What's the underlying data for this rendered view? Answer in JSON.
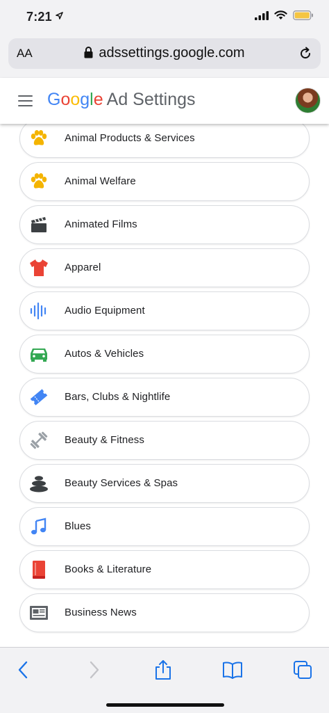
{
  "status_bar": {
    "time": "7:21"
  },
  "browser": {
    "aa_label": "AA",
    "url": "adssettings.google.com"
  },
  "header": {
    "logo_letters": [
      "G",
      "o",
      "o",
      "g",
      "l",
      "e"
    ],
    "title": "Ad Settings"
  },
  "categories": [
    {
      "label": "",
      "icon": "partial-item"
    },
    {
      "label": "Animal Products & Services",
      "icon": "paw-icon",
      "color": "#f4b400"
    },
    {
      "label": "Animal Welfare",
      "icon": "paw-icon",
      "color": "#f4b400"
    },
    {
      "label": "Animated Films",
      "icon": "clapperboard-icon",
      "color": "#3c4043"
    },
    {
      "label": "Apparel",
      "icon": "tshirt-icon",
      "color": "#ea4335"
    },
    {
      "label": "Audio Equipment",
      "icon": "sound-wave-icon",
      "color": "#4285f4"
    },
    {
      "label": "Autos & Vehicles",
      "icon": "car-icon",
      "color": "#34a853"
    },
    {
      "label": "Bars, Clubs & Nightlife",
      "icon": "ticket-icon",
      "color": "#4285f4"
    },
    {
      "label": "Beauty & Fitness",
      "icon": "dumbbell-icon",
      "color": "#9aa0a6"
    },
    {
      "label": "Beauty Services & Spas",
      "icon": "spa-stones-icon",
      "color": "#3c4043"
    },
    {
      "label": "Blues",
      "icon": "music-note-icon",
      "color": "#4285f4"
    },
    {
      "label": "Books & Literature",
      "icon": "book-icon",
      "color": "#ea4335"
    },
    {
      "label": "Business News",
      "icon": "newspaper-icon",
      "color": "#5f6368"
    }
  ],
  "colors": {
    "ios_blue": "#1a73e8",
    "google_blue": "#4285f4",
    "google_red": "#ea4335",
    "google_yellow": "#fbbc05",
    "google_green": "#34a853"
  }
}
